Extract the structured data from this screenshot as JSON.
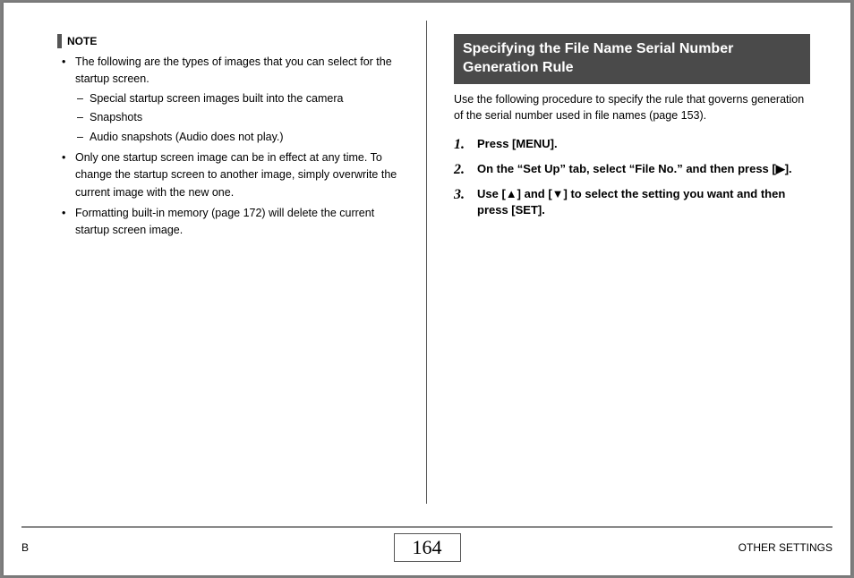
{
  "left": {
    "noteLabel": "NOTE",
    "bullets": {
      "b1": "The following are the types of images that you can select for the startup screen.",
      "b1_sub1": "Special startup screen images built into the camera",
      "b1_sub2": "Snapshots",
      "b1_sub3": "Audio snapshots (Audio does not play.)",
      "b2": "Only one startup screen image can be in effect at any time. To change the startup screen to another image, simply overwrite the current image with the new one.",
      "b3": "Formatting built-in memory (page 172) will delete the current startup screen image."
    }
  },
  "right": {
    "title": "Specifying the File Name Serial Number Generation Rule",
    "intro": "Use the following procedure to specify the rule that governs generation of the serial number used in file names (page 153).",
    "steps": {
      "s1": "Press [MENU].",
      "s2": "On the “Set Up” tab, select “File No.” and then press [▶].",
      "s3": "Use [▲] and [▼] to select the setting you want and then press [SET]."
    }
  },
  "footer": {
    "left": "B",
    "page": "164",
    "right": "OTHER SETTINGS"
  }
}
